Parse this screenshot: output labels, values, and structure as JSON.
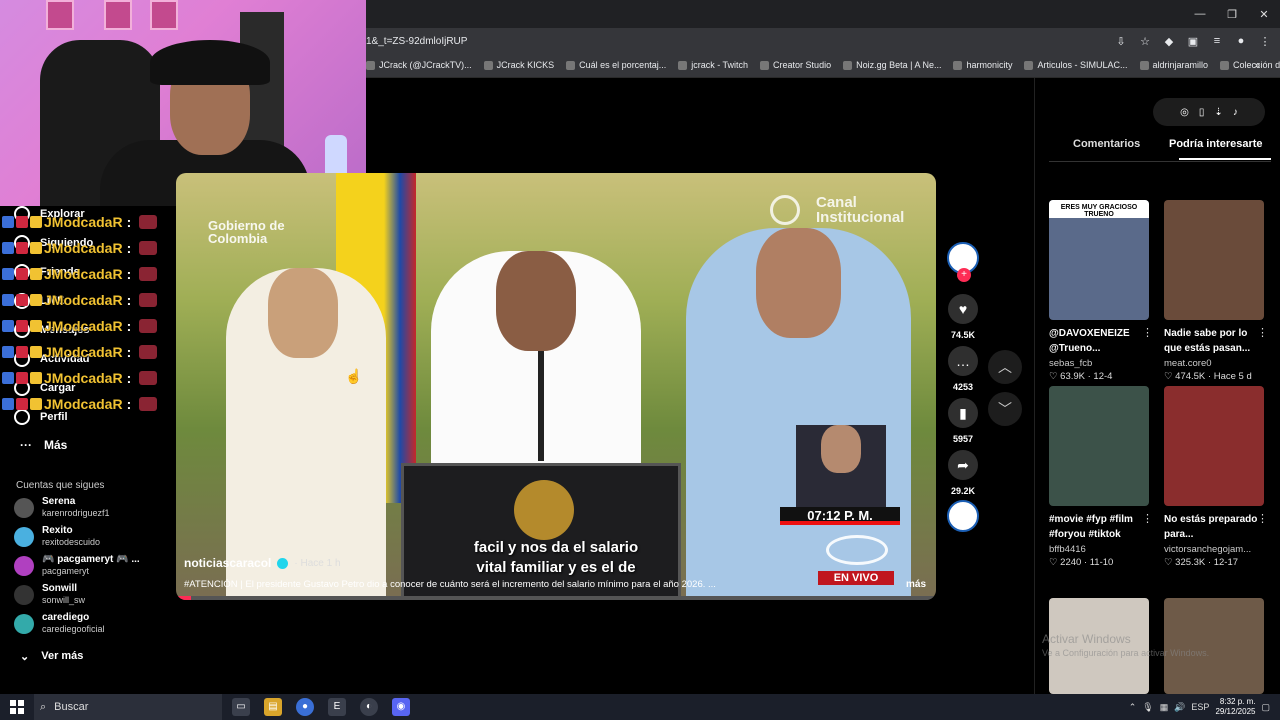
{
  "browser": {
    "url": "1&_t=ZS-92dmloIjRUP",
    "window_buttons": [
      "—",
      "❐",
      "✕"
    ],
    "bookmarks": [
      "JCrack (@JCrackTV)...",
      "JCrack KICKS",
      "Cuál es el porcentaj...",
      "jcrack - Twitch",
      "Creator Studio",
      "Noiz.gg Beta | A Ne...",
      "harmonicity",
      "Articulos - SIMULAC...",
      "aldrinjaramillo",
      "Colección de M_blei..."
    ],
    "bookmarks_more": "»"
  },
  "sidebar": {
    "nav": [
      {
        "label": "Explorar"
      },
      {
        "label": "Siguiendo"
      },
      {
        "label": "Friends"
      },
      {
        "label": "LIVE"
      },
      {
        "label": "Mensajes"
      },
      {
        "label": "Actividad"
      },
      {
        "label": "Cargar"
      },
      {
        "label": "Perfil"
      }
    ],
    "chat_user": "JModcadaR",
    "chat_colon": ":",
    "chat_rows": 8,
    "more": "Más",
    "following_title": "Cuentas que sigues",
    "accounts": [
      {
        "name": "Serena",
        "handle": "karenrodriguezf1"
      },
      {
        "name": "Rexito",
        "handle": "rexitodescuido"
      },
      {
        "name": "🎮 pacgameryt 🎮 ...",
        "handle": "pacgameryt"
      },
      {
        "name": "Sonwill",
        "handle": "sonwill_sw"
      },
      {
        "name": "carediego",
        "handle": "carediegooficial"
      }
    ],
    "see_more": "Ver más"
  },
  "video": {
    "watermark_left": "Gobierno de\nColombia",
    "watermark_right": "Canal\nInstitucional",
    "subtitle_line1": "facil y nos da el salario",
    "subtitle_line2": "vital familiar y es el de",
    "time_badge": "07:12 P. M.",
    "live_badge": "EN VIVO",
    "author": "noticiascaracol",
    "ago": "· Hace 1 h",
    "description": "#ATENCIÓN | El presidente Gustavo Petro dio a conocer de cuánto será el incremento del salario mínimo para el año 2026. ...",
    "more": "más",
    "progress": 0.02
  },
  "actions": {
    "likes": "74.5K",
    "comments": "4253",
    "saves": "5957",
    "shares": "29.2K",
    "follow_plus": "+"
  },
  "right_panel": {
    "tabs": [
      "Comentarios",
      "Podría interesarte"
    ],
    "active_tab": 1,
    "cards": [
      {
        "thumb_text": "ERES MUY GRACIOSO TRUENO",
        "caption": "@DAVOXENEIZE @Trueno...",
        "channel": "sebas_fcb",
        "stats": "♡ 63.9K · 12-4",
        "thumb_color": "#5a6a8a"
      },
      {
        "thumb_text": "",
        "caption": "Nadie sabe por lo que estás pasan...",
        "channel": "meat.core0",
        "stats": "♡ 474.5K · Hace 5 d",
        "thumb_color": "#6a4b3a"
      },
      {
        "thumb_text": "",
        "caption": "#movie #fyp #film #foryou #tiktok",
        "channel": "bffb4416",
        "stats": "♡ 2240 · 11-10",
        "thumb_color": "#3c5249"
      },
      {
        "thumb_text": "",
        "caption": "No estás preparado para...",
        "channel": "victorsanchegojam...",
        "stats": "♡ 325.3K · 12-17",
        "thumb_color": "#8a2d2d"
      },
      {
        "thumb_text": "",
        "caption": "",
        "channel": "",
        "stats": "",
        "thumb_color": "#cfc8bf"
      },
      {
        "thumb_text": "",
        "caption": "",
        "channel": "",
        "stats": "",
        "thumb_color": "#6e5a48"
      }
    ]
  },
  "watermark": {
    "line1": "Activar Windows",
    "line2": "Ve a Configuración para activar Windows."
  },
  "taskbar": {
    "search_placeholder": "Buscar",
    "lang": "ESP",
    "time": "8:32 p. m.",
    "date": "29/12/2025"
  }
}
